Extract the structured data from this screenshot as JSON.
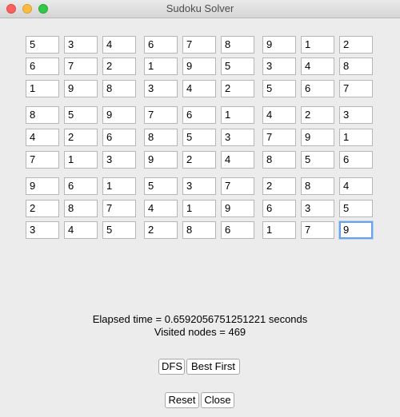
{
  "window": {
    "title": "Sudoku Solver"
  },
  "grid": {
    "rows": [
      [
        "5",
        "3",
        "4",
        "6",
        "7",
        "8",
        "9",
        "1",
        "2"
      ],
      [
        "6",
        "7",
        "2",
        "1",
        "9",
        "5",
        "3",
        "4",
        "8"
      ],
      [
        "1",
        "9",
        "8",
        "3",
        "4",
        "2",
        "5",
        "6",
        "7"
      ],
      [
        "8",
        "5",
        "9",
        "7",
        "6",
        "1",
        "4",
        "2",
        "3"
      ],
      [
        "4",
        "2",
        "6",
        "8",
        "5",
        "3",
        "7",
        "9",
        "1"
      ],
      [
        "7",
        "1",
        "3",
        "9",
        "2",
        "4",
        "8",
        "5",
        "6"
      ],
      [
        "9",
        "6",
        "1",
        "5",
        "3",
        "7",
        "2",
        "8",
        "4"
      ],
      [
        "2",
        "8",
        "7",
        "4",
        "1",
        "9",
        "6",
        "3",
        "5"
      ],
      [
        "3",
        "4",
        "5",
        "2",
        "8",
        "6",
        "1",
        "7",
        "9"
      ]
    ],
    "focused_cell": [
      8,
      8
    ]
  },
  "status": {
    "elapsed": "Elapsed time = 0.6592056751251221 seconds",
    "visited": "Visited nodes = 469"
  },
  "buttons": {
    "dfs": "DFS",
    "best_first": "Best First",
    "reset": "Reset",
    "close": "Close"
  },
  "colors": {
    "focus_ring": "#6aa2e6",
    "close": "#fc605c",
    "minimize": "#fdbc40",
    "maximize": "#34c84a"
  }
}
